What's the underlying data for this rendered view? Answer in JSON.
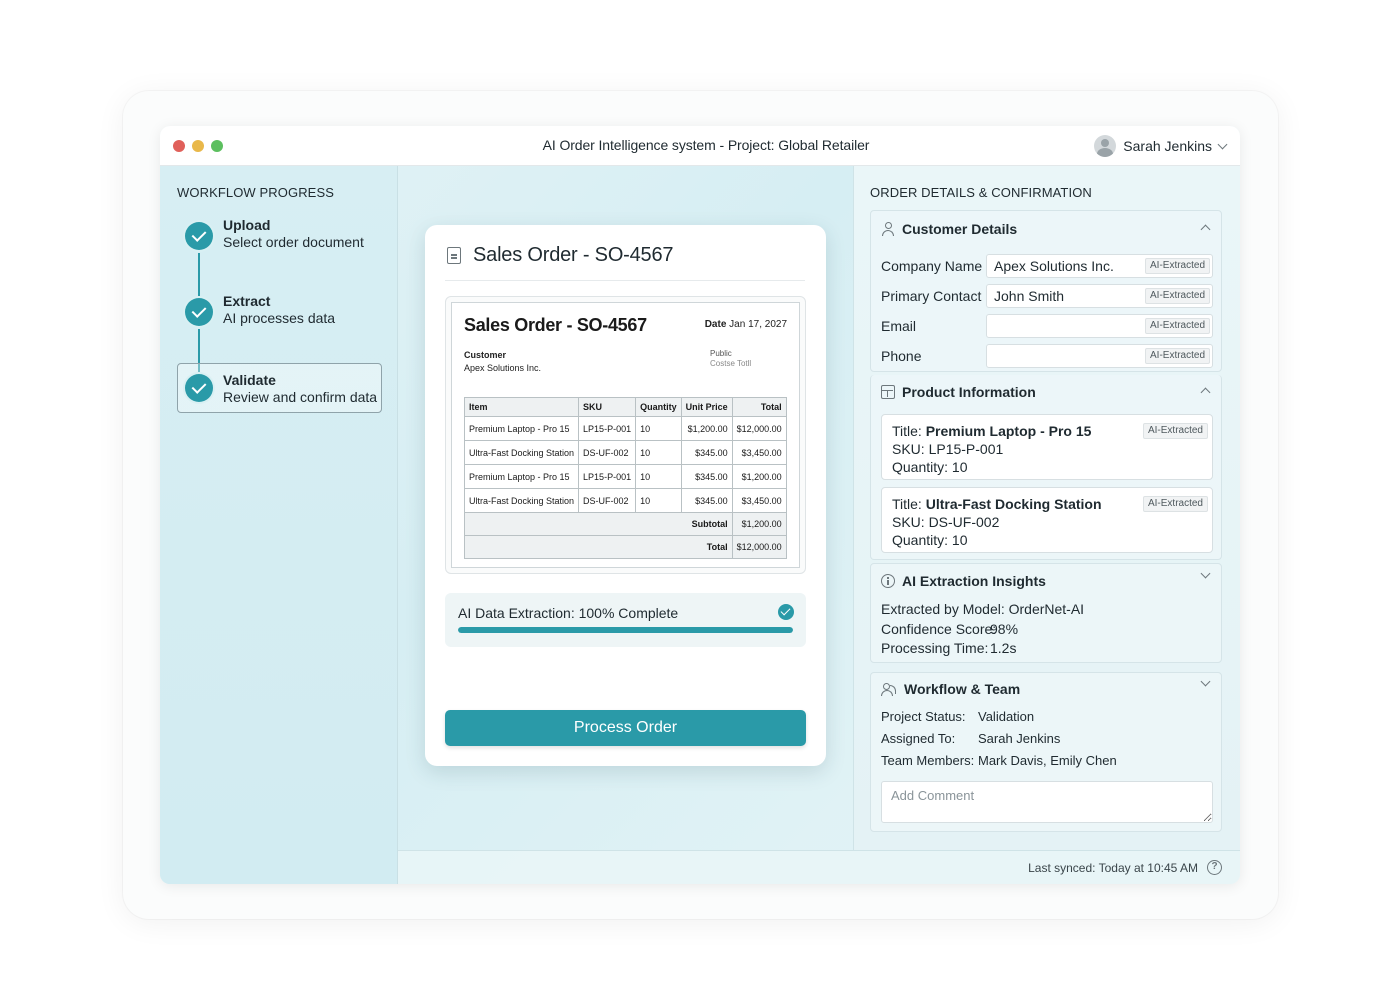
{
  "window": {
    "title": "AI Order Intelligence system - Project: Global Retailer",
    "user_name": "Sarah Jenkins"
  },
  "sidebar": {
    "title": "WORKFLOW PROGRESS",
    "steps": [
      {
        "title": "Upload",
        "subtitle": "Select order document",
        "status": "complete"
      },
      {
        "title": "Extract",
        "subtitle": "AI processes data",
        "status": "complete"
      },
      {
        "title": "Validate",
        "subtitle": "Review and confirm data",
        "status": "active"
      }
    ]
  },
  "document": {
    "header_title": "Sales Order - SO-4567",
    "preview": {
      "title": "Sales Order - SO-4567",
      "date_label": "Date",
      "date_value": "Jan 17, 2027",
      "customer_label": "Customer",
      "customer_value": "Apex Solutions Inc.",
      "stamp_line_1": "Public",
      "stamp_line_2": "Costse Totll",
      "columns": [
        "Item",
        "SKU",
        "Quantity",
        "Unit Price",
        "Total"
      ],
      "rows": [
        [
          "Premium Laptop - Pro 15",
          "LP15-P-001",
          "10",
          "$1,200.00",
          "$12,000.00"
        ],
        [
          "Ultra-Fast Docking Station",
          "DS-UF-002",
          "10",
          "$345.00",
          "$3,450.00"
        ],
        [
          "Premium Laptop - Pro 15",
          "LP15-P-001",
          "10",
          "$345.00",
          "$1,200.00"
        ],
        [
          "Ultra-Fast Docking Station",
          "DS-UF-002",
          "10",
          "$345.00",
          "$3,450.00"
        ]
      ],
      "subtotal_label": "Subtotal",
      "subtotal_value": "$1,200.00",
      "total_label": "Total",
      "total_value": "$12,000.00"
    },
    "progress": {
      "label": "AI Data Extraction: 100% Complete",
      "percent": 100
    },
    "process_button": "Process Order"
  },
  "details": {
    "title": "ORDER DETAILS & CONFIRMATION",
    "badge": "AI-Extracted",
    "customer": {
      "title": "Customer Details",
      "fields": [
        {
          "label": "Company Name",
          "value": "Apex Solutions Inc."
        },
        {
          "label": "Primary Contact",
          "value": "John Smith"
        },
        {
          "label": "Email",
          "value": ""
        },
        {
          "label": "Phone",
          "value": ""
        }
      ]
    },
    "products": {
      "title": "Product Information",
      "items": [
        {
          "title_label": "Title:",
          "title": "Premium Laptop - Pro 15",
          "sku": "SKU: LP15-P-001",
          "quantity": "Quantity: 10"
        },
        {
          "title_label": "Title:",
          "title": "Ultra-Fast Docking Station",
          "sku": "SKU: DS-UF-002",
          "quantity": "Quantity: 10"
        }
      ]
    },
    "insights": {
      "title": "AI Extraction Insights",
      "model": "Extracted by Model: OrderNet-AI",
      "confidence_label": "Confidence Score:",
      "confidence_value": "98%",
      "time_label": "Processing Time:",
      "time_value": "1.2s"
    },
    "workflow": {
      "title": "Workflow & Team",
      "status_label": "Project Status:",
      "status_value": "Validation",
      "assigned_label": "Assigned To:",
      "assigned_value": "Sarah Jenkins",
      "members_label": "Team Members:",
      "members_value": "Mark Davis, Emily Chen",
      "comment_placeholder": "Add Comment"
    }
  },
  "footer": {
    "sync_text": "Last synced: Today at 10:45 AM"
  },
  "colors": {
    "accent": "#2a9aa8",
    "sidebar_bg": "#d7eef3"
  }
}
